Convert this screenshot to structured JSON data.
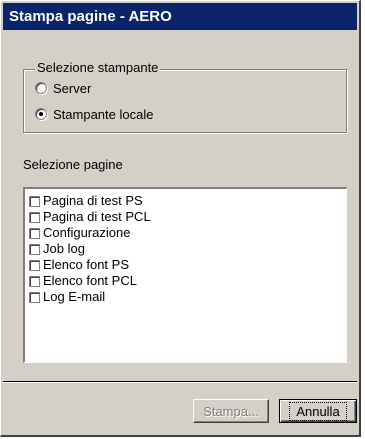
{
  "window": {
    "title": "Stampa pagine - AERO"
  },
  "printer_selection": {
    "legend": "Selezione stampante",
    "options": [
      {
        "label": "Server",
        "checked": false
      },
      {
        "label": "Stampante locale",
        "checked": true
      }
    ]
  },
  "page_selection": {
    "label": "Selezione pagine",
    "items": [
      {
        "label": "Pagina di test PS",
        "checked": false
      },
      {
        "label": "Pagina di test PCL",
        "checked": false
      },
      {
        "label": "Configurazione",
        "checked": false
      },
      {
        "label": "Job log",
        "checked": false
      },
      {
        "label": "Elenco font PS",
        "checked": false
      },
      {
        "label": "Elenco font PCL",
        "checked": false
      },
      {
        "label": "Log E-mail",
        "checked": false
      }
    ]
  },
  "buttons": {
    "print_label": "Stampa...",
    "print_enabled": false,
    "cancel_label": "Annulla"
  }
}
